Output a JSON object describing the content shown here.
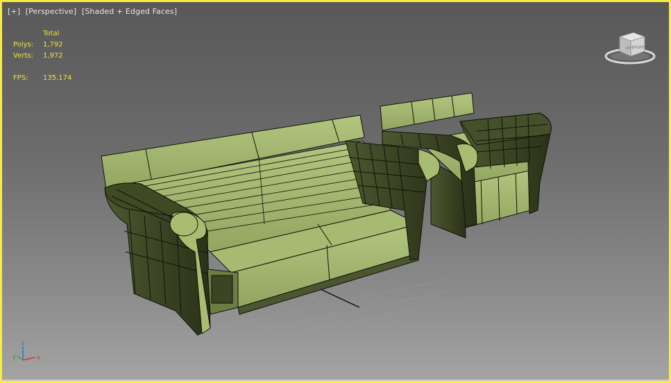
{
  "viewport": {
    "labels": [
      "[+]",
      "[Perspective]",
      "[Shaded + Edged Faces]"
    ],
    "border_color": "#f6ee3c"
  },
  "stats": {
    "header": "Total",
    "rows": [
      {
        "key": "Polys:",
        "value": "1,792"
      },
      {
        "key": "Verts:",
        "value": "1,972"
      }
    ],
    "fps_key": "FPS:",
    "fps_value": "135.174",
    "color": "#f0e23a"
  },
  "viewcube": {
    "face_top": "TOP",
    "face_left": "LEFT",
    "face_front": "FRONT"
  },
  "axis": {
    "x": "x",
    "y": "y",
    "z": "z"
  },
  "model": {
    "face_color": "#9caf6a",
    "shade_color": "#6e7d44",
    "edge_color": "#0f1208"
  }
}
